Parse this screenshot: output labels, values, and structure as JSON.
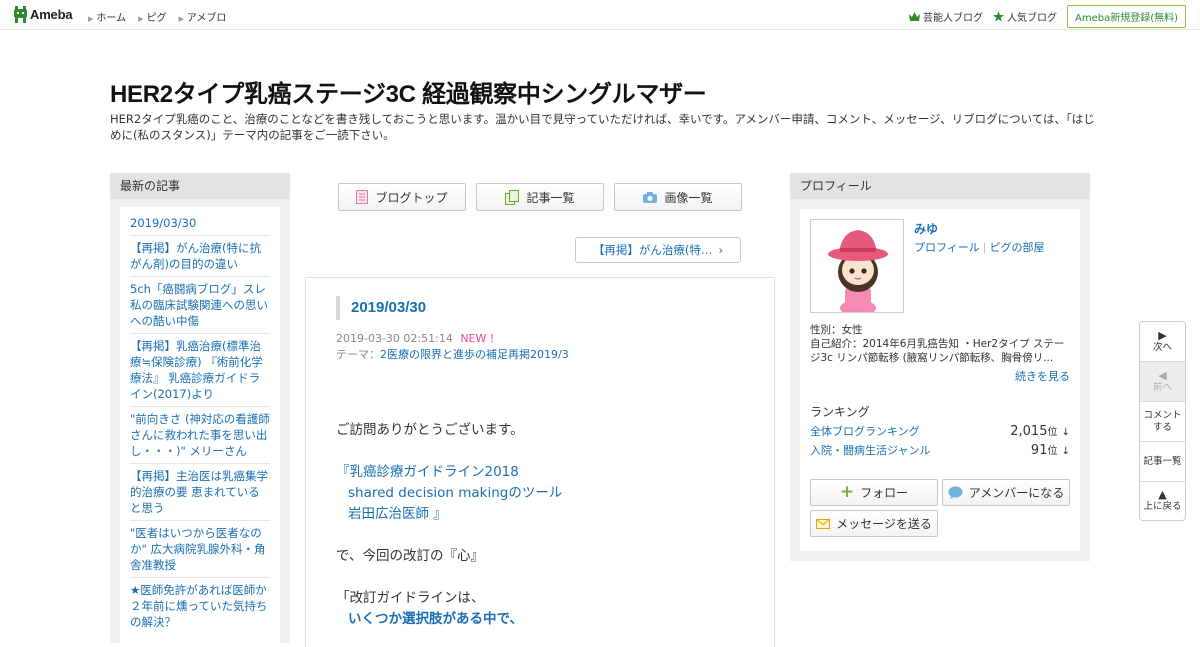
{
  "topbar": {
    "logo_text": "Ameba",
    "nav": [
      "ホーム",
      "ピグ",
      "アメブロ"
    ],
    "right_links": [
      "芸能人ブログ",
      "人気ブログ"
    ],
    "register_label": "Ameba新規登録(無料)",
    "accent": "#2e8b2e"
  },
  "header": {
    "title": "HER2タイプ乳癌ステージ3C 経過観察中シングルマザー",
    "description": "HER2タイプ乳癌のこと、治療のことなどを書き残しておこうと思います。温かい目で見守っていただければ、幸いです。アメンバー申請、コメント、メッセージ、リブログについては、「はじめに(私のスタンス)」テーマ内の記事をご一読下さい。"
  },
  "left_panel": {
    "heading": "最新の記事",
    "items": [
      "2019/03/30",
      "【再掲】がん治療(特に抗がん剤)の目的の違い",
      "5ch「癌闘病ブログ」スレ 私の臨床試験関連への思いへの酷い中傷",
      "【再掲】乳癌治療(標準治療≒保険診療) 『術前化学療法』 乳癌診療ガイドライン(2017)より",
      "\"前向きさ (神対応の看護師さんに救われた事を思い出し・・・)\" メリーさん",
      "【再掲】主治医は乳癌集学的治療の要 恵まれていると思う",
      "\"医者はいつから医者なのか\" 広大病院乳腺外科・角舎准教授",
      "★医師免許があれば医師か ２年前に燻っていた気持ちの解決？"
    ]
  },
  "center": {
    "nav_buttons": [
      "ブログトップ",
      "記事一覧",
      "画像一覧"
    ],
    "next_entry": "【再掲】がん治療(特…",
    "article": {
      "title": "2019/03/30",
      "datetime": "2019-03-30 02:51:14",
      "new_badge": "NEW !",
      "theme_label": "テーマ：",
      "theme": "2医療の限界と進歩の補足再掲2019/3",
      "body": {
        "line1": "ご訪問ありがとうございます。",
        "quote_open": "『",
        "quote_line1": "乳癌診療ガイドライン2018",
        "quote_line2": "shared decision makingのツール",
        "quote_line3": "岩田広治医師",
        "quote_close": "』",
        "line2": "で、今回の改訂の『心』",
        "line3": "「改訂ガイドラインは、",
        "line4": "いくつか選択肢がある中で、"
      }
    }
  },
  "profile": {
    "heading": "プロフィール",
    "name": "みゆ",
    "link1": "プロフィール",
    "link2": "ピグの部屋",
    "gender": "性別：女性",
    "intro": "自己紹介：2014年6月乳癌告知 ・Her2タイプ ステージ3c リンパ節転移 (腋窩リンパ節転移、胸骨傍リ...",
    "more": "続きを見る",
    "ranking_heading": "ランキング",
    "ranks": [
      {
        "label": "全体ブログランキング",
        "value": "2,015",
        "unit": "位",
        "arrow": "↓"
      },
      {
        "label": "入院・闘病生活ジャンル",
        "value": "91",
        "unit": "位",
        "arrow": "↓"
      }
    ],
    "follow": "フォロー",
    "amember": "アメンバーになる",
    "message": "メッセージを送る"
  },
  "sidenav": {
    "next": "次へ",
    "prev": "前へ",
    "comment": "コメントする",
    "list": "記事一覧",
    "top": "上に戻る"
  }
}
